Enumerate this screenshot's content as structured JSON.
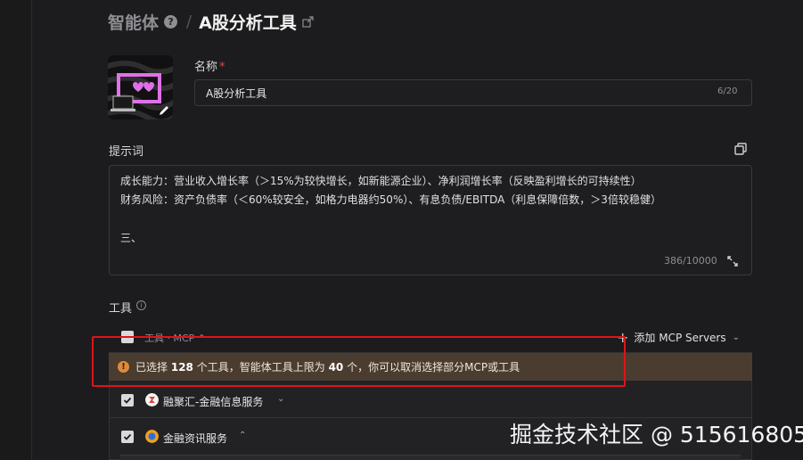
{
  "header": {
    "root_label": "智能体",
    "separator": "/",
    "title": "A股分析工具"
  },
  "name_field": {
    "label": "名称",
    "required_mark": "*",
    "value": "A股分析工具",
    "counter": "6/20"
  },
  "prompt": {
    "label": "提示词",
    "lines": [
      "成长能力：营业收入增长率（＞15%为较快增长，如新能源企业）、净利润增长率（反映盈利增长的可持续性）",
      "财务风险：资产负债率（＜60%较安全，如格力电器约50%）、有息负债/EBITDA（利息保障倍数，＞3倍较稳健）",
      "三、"
    ],
    "counter": "386/10000"
  },
  "tools": {
    "label": "工具",
    "header_text": "工具 · MCP ⌃",
    "add_button": "添加 MCP Servers",
    "warning": {
      "prefix": "已选择",
      "selected_count": "128",
      "mid": "个工具，智能体工具上限为",
      "limit": "40",
      "suffix": "个，你可以取消选择部分MCP或工具"
    },
    "servers": [
      {
        "name": "融聚汇-金融信息服务",
        "chevron": "⌄",
        "logo_color": "#e0433a"
      },
      {
        "name": "金融资讯服务",
        "chevron": "⌃",
        "logo_color": "#f0a020"
      }
    ]
  },
  "watermark": "掘金技术社区 @ 515616805",
  "icons": {
    "help": "help-icon",
    "share": "share-icon",
    "copy": "copy-icon",
    "expand": "expand-icon",
    "info": "info-icon",
    "warning": "warning-icon",
    "edit": "edit-pencil-icon"
  },
  "colors": {
    "background": "#1c1c1e",
    "warning_bg": "#4a3d30",
    "warning_icon": "#e08a3a",
    "annotation_red": "#e0131a",
    "required": "#e04848",
    "avatar_accent": "#e070e8"
  }
}
